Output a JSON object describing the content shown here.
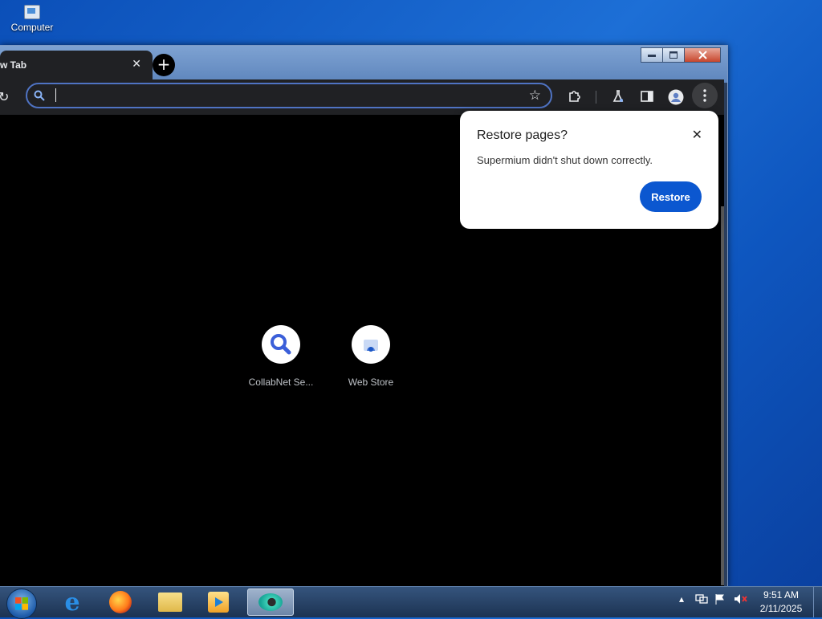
{
  "desktop": {
    "icons": [
      {
        "label": "Computer",
        "icon": "computer-icon"
      }
    ]
  },
  "browser": {
    "tab": {
      "title": "w Tab"
    },
    "toolbar": {
      "omnibox_value": "",
      "omnibox_placeholder": ""
    },
    "shortcuts": [
      {
        "label": "CollabNet Se...",
        "icon": "search-icon"
      },
      {
        "label": "Web Store",
        "icon": "web-store-icon"
      }
    ],
    "popup": {
      "title": "Restore pages?",
      "message": "Supermium didn't shut down correctly.",
      "button_label": "Restore"
    }
  },
  "taskbar": {
    "items": [
      "start-button",
      "internet-explorer-icon",
      "firefox-icon",
      "file-explorer-icon",
      "media-player-icon",
      "supermium-icon"
    ],
    "clock": {
      "time": "9:51 AM",
      "date": "2/11/2025"
    }
  },
  "colors": {
    "accent": "#0b57d0",
    "browser_bg": "#202124",
    "page_bg": "#000000"
  }
}
